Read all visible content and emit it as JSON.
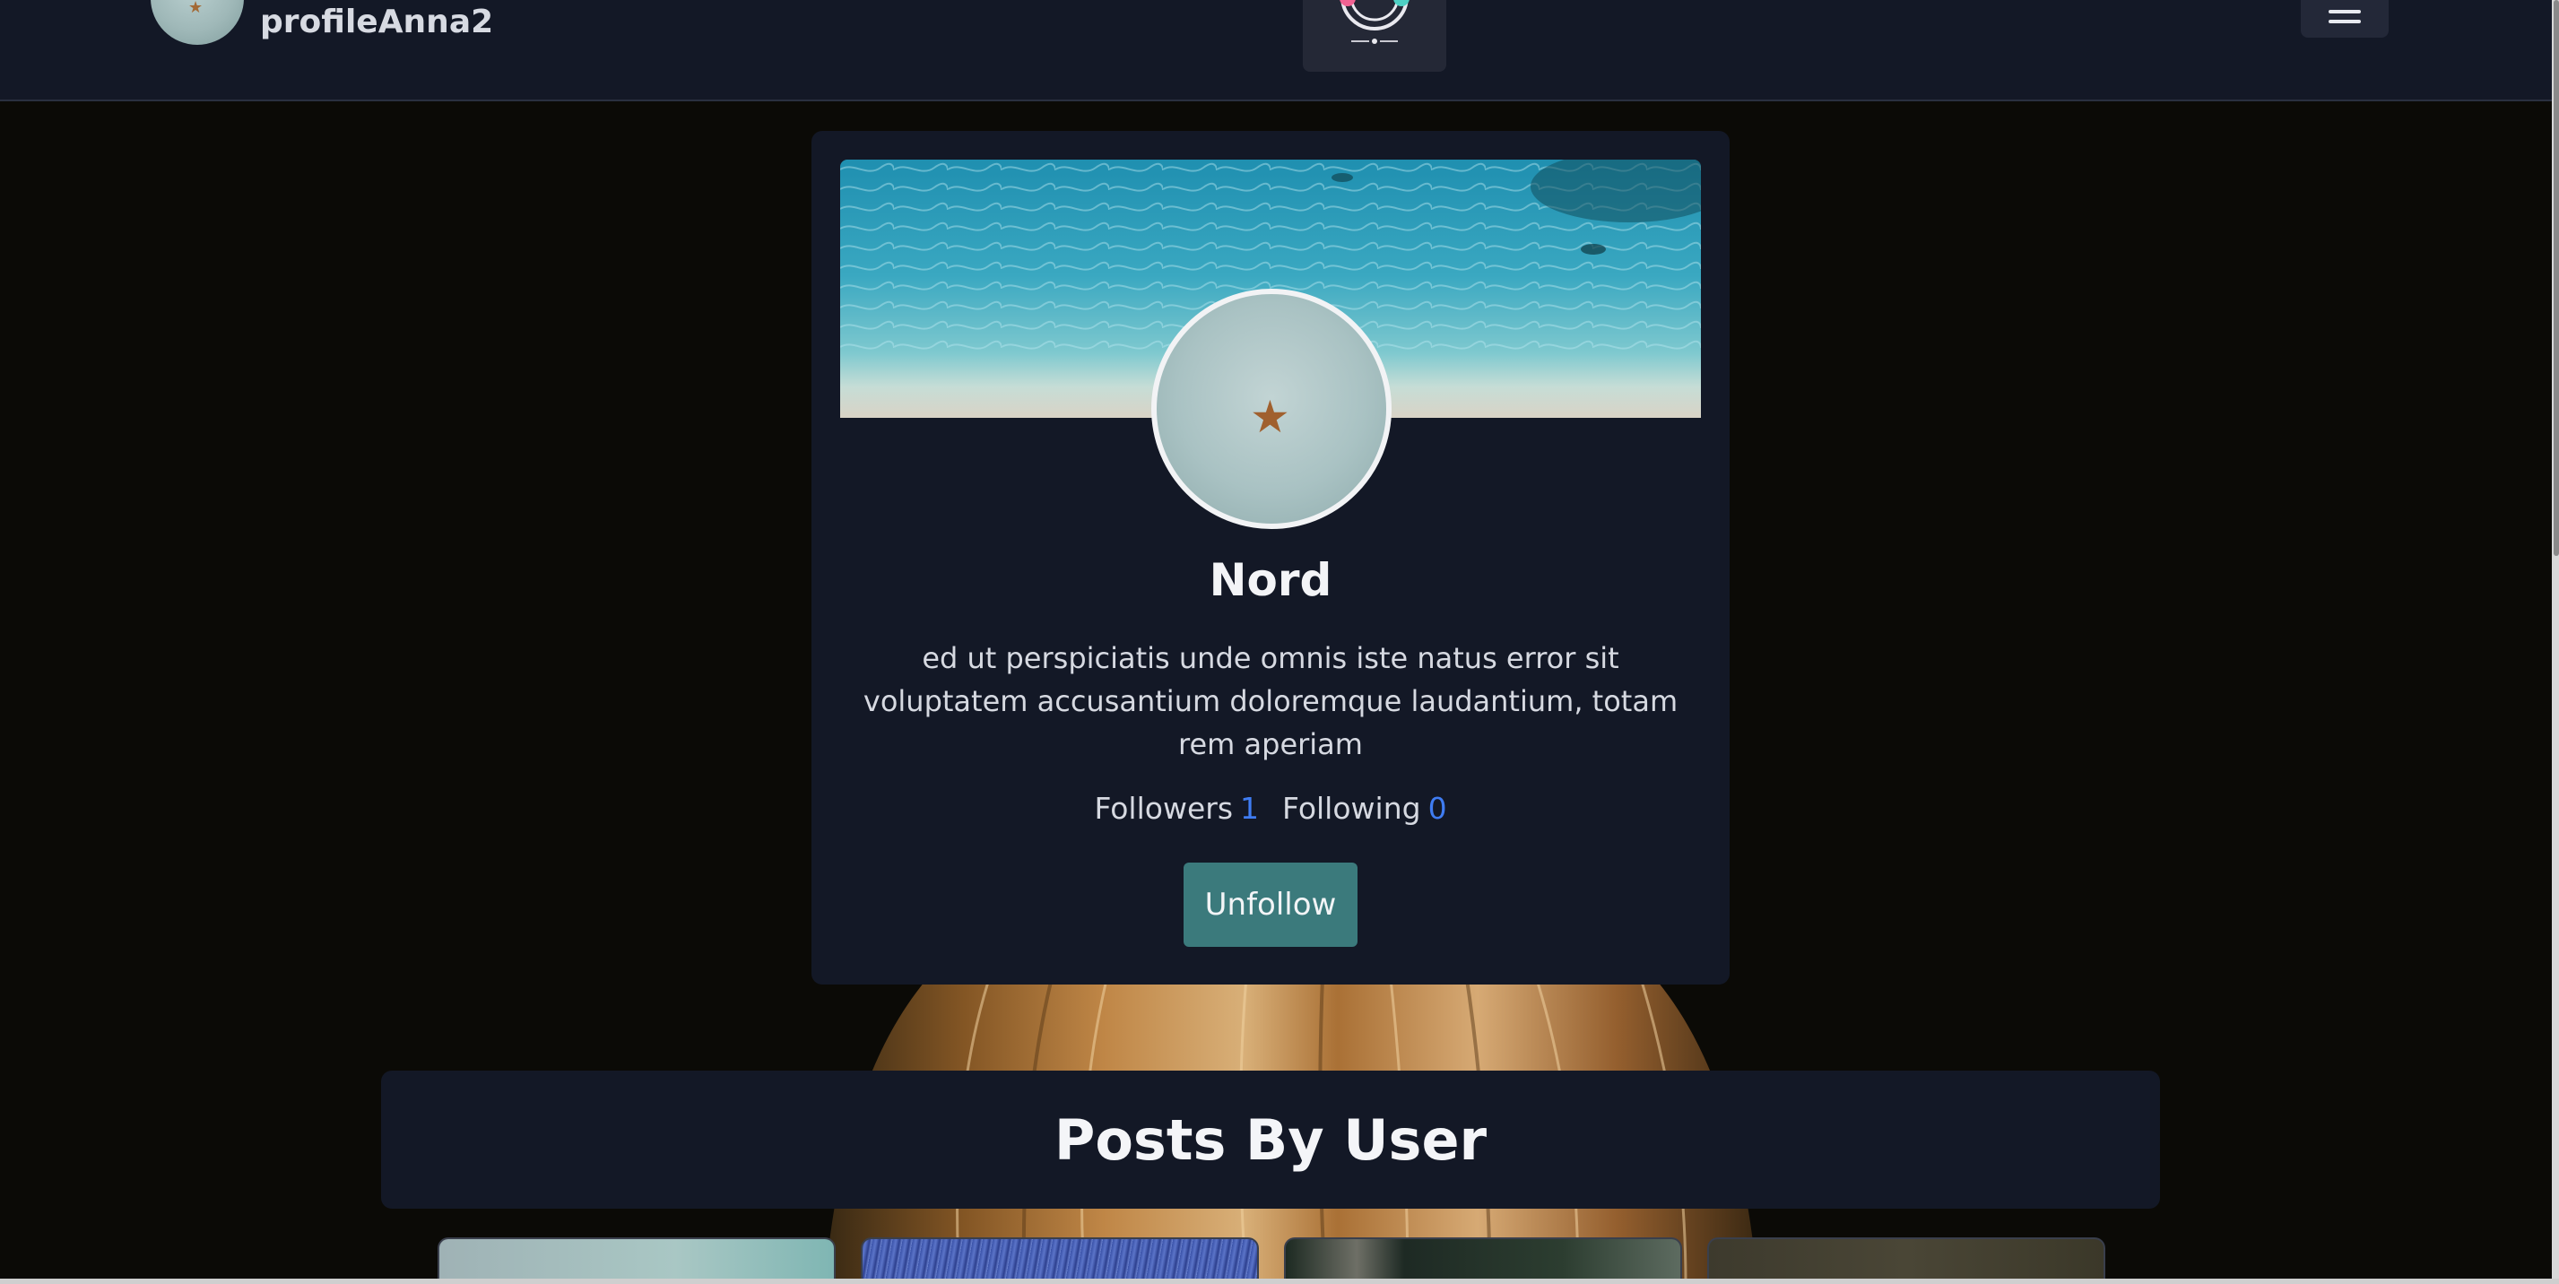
{
  "header": {
    "username": "profileAnna2",
    "avatar_icon": "starfish-avatar-icon",
    "logo_icon": "app-logo-icon",
    "menu_icon": "hamburger-menu-icon"
  },
  "profile": {
    "name": "Nord",
    "bio": "ed ut perspiciatis unde omnis iste natus error sit voluptatem accusantium doloremque laudantium, totam rem aperiam",
    "followers_label": "Followers",
    "followers_count": "1",
    "following_label": "Following",
    "following_count": "0",
    "unfollow_label": "Unfollow"
  },
  "posts": {
    "title": "Posts By User",
    "thumbnails": [
      "post-thumbnail-1",
      "post-thumbnail-2",
      "post-thumbnail-3",
      "post-thumbnail-4"
    ]
  },
  "colors": {
    "page_background": "#0b0a06",
    "card_background": "#131826",
    "accent_blue": "#3f7cf2",
    "button_teal": "#3b7a7c"
  }
}
